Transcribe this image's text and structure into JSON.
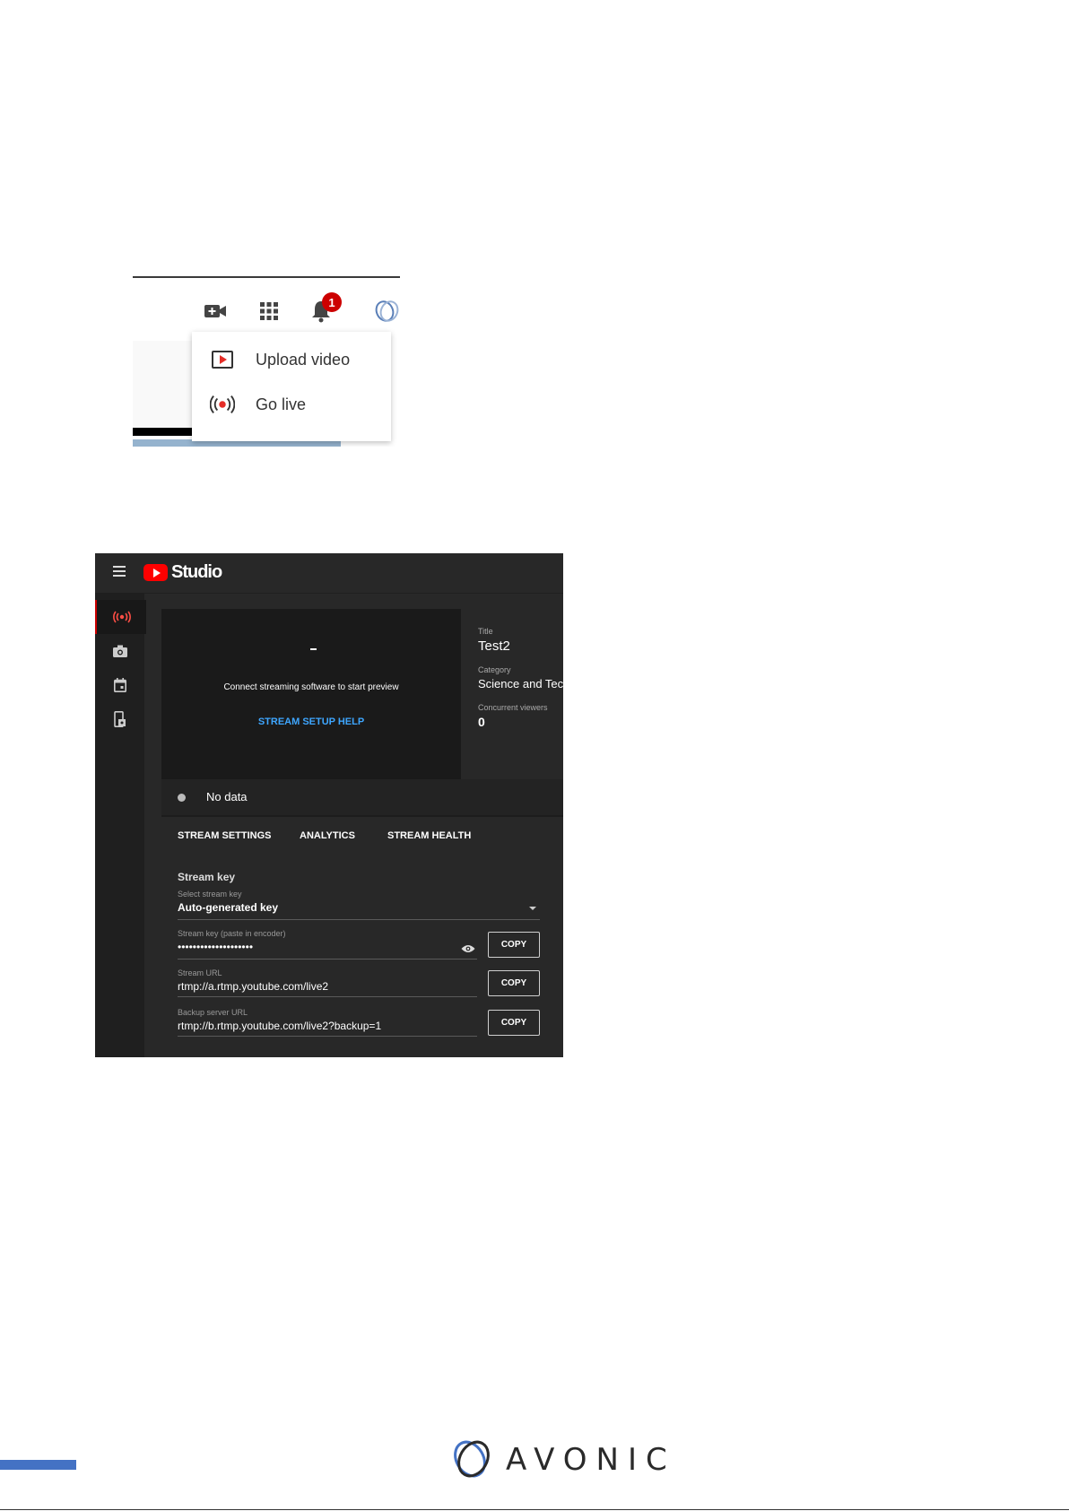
{
  "shot1": {
    "notification_count": "1",
    "menu": {
      "upload_label": "Upload video",
      "golive_label": "Go live"
    },
    "colors": {
      "badge": "#cc0000",
      "live_red": "#e52d27"
    }
  },
  "shot2": {
    "app": {
      "name": "Studio"
    },
    "preview": {
      "message": "Connect streaming software to start preview",
      "help_link": "STREAM SETUP HELP"
    },
    "info": {
      "title_label": "Title",
      "title_value": "Test2",
      "category_label": "Category",
      "category_value": "Science and Tech",
      "viewers_label": "Concurrent viewers",
      "viewers_value": "0"
    },
    "status": "No data",
    "tabs": [
      "STREAM SETTINGS",
      "ANALYTICS",
      "STREAM HEALTH"
    ],
    "stream_settings": {
      "section_title": "Stream key",
      "select_key_label": "Select stream key",
      "select_key_value": "Auto-generated key",
      "key_label": "Stream key (paste in encoder)",
      "key_value": "••••••••••••••••••••",
      "url_label": "Stream URL",
      "url_value": "rtmp://a.rtmp.youtube.com/live2",
      "backup_label": "Backup server URL",
      "backup_value": "rtmp://b.rtmp.youtube.com/live2?backup=1",
      "copy_label": "COPY"
    },
    "colors": {
      "accent_blue": "#3ea6ff",
      "youtube_red": "#ff0000"
    }
  },
  "footer": {
    "brand": "AVONIC",
    "accent": "#4472c4"
  }
}
